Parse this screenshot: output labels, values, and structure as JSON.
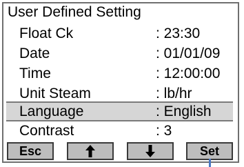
{
  "title": "User Defined Setting",
  "rows": [
    {
      "label": "Float Ck",
      "value": ": 23:30"
    },
    {
      "label": "Date",
      "value": ": 01/01/09"
    },
    {
      "label": "Time",
      "value": ": 12:00:00"
    },
    {
      "label": "Unit Steam",
      "value": ": lb/hr"
    },
    {
      "label": "Language",
      "value": ": English",
      "selected": true
    },
    {
      "label": "Contrast",
      "value": ": 3"
    }
  ],
  "buttons": {
    "esc_label": "Esc",
    "up_icon": "arrow-up-icon",
    "down_icon": "arrow-down-icon",
    "set_label": "Set"
  },
  "colors": {
    "selected_row": "#d6d6d6",
    "button_face": "#bdbdbd",
    "pointer": "#4a78c4"
  }
}
